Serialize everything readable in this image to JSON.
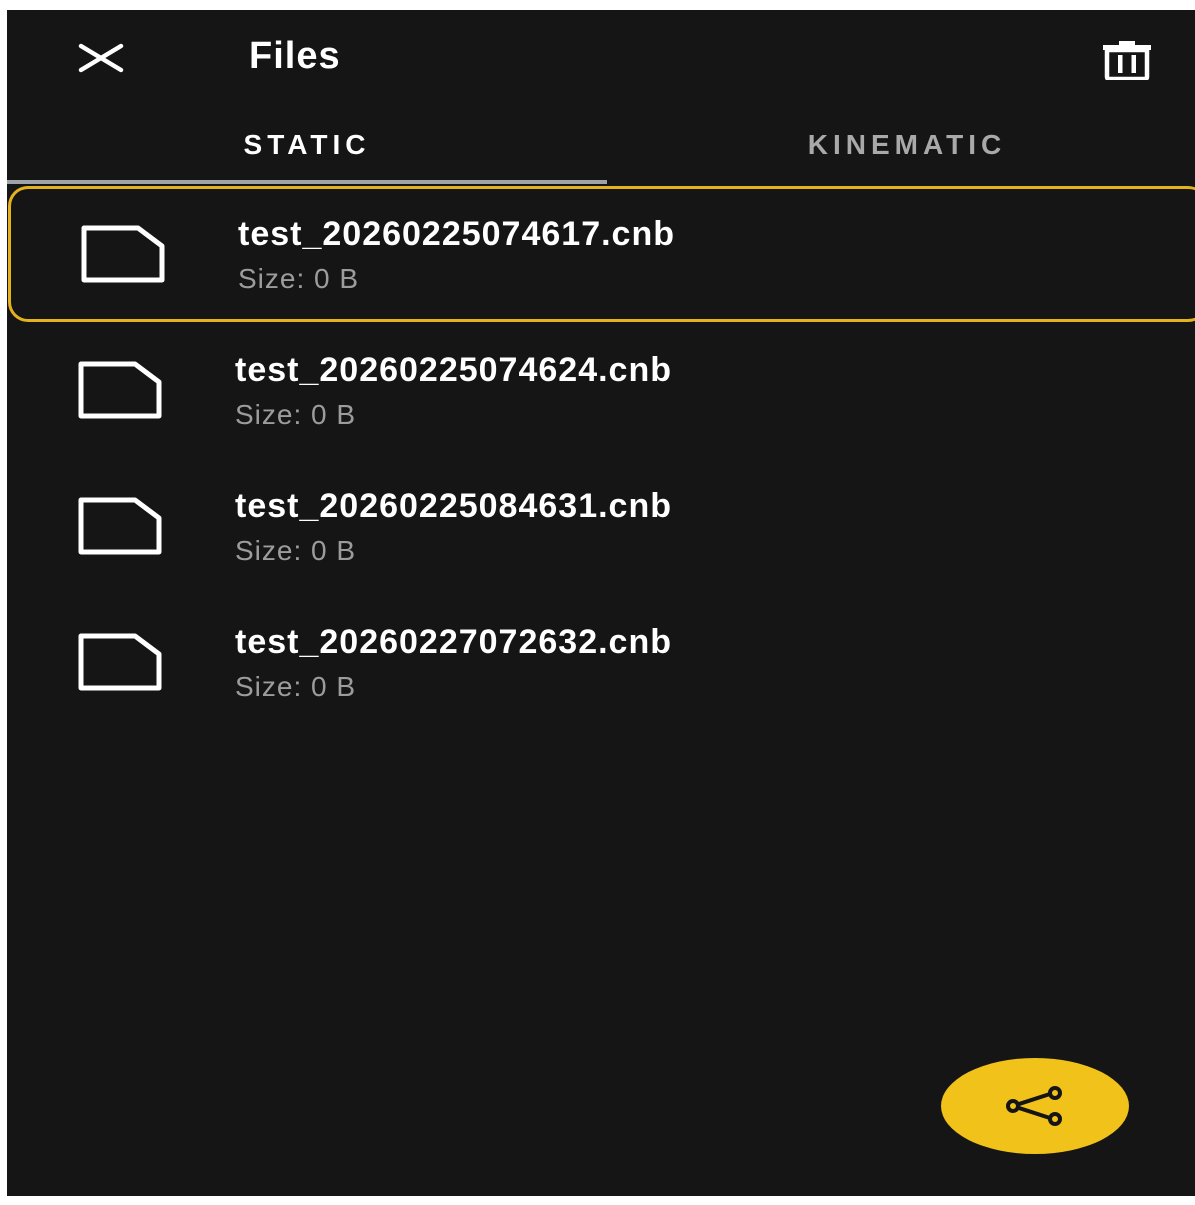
{
  "appbar": {
    "title": "Files",
    "close_icon": "close-icon",
    "delete_icon": "trash-icon"
  },
  "tabs": [
    {
      "label": "STATIC",
      "selected": true
    },
    {
      "label": "KINEMATIC",
      "selected": false
    }
  ],
  "files": [
    {
      "name": "test_20260225074617.cnb",
      "size": "Size: 0 B",
      "selected": true
    },
    {
      "name": "test_20260225074624.cnb",
      "size": "Size: 0 B",
      "selected": false
    },
    {
      "name": "test_20260225084631.cnb",
      "size": "Size: 0 B",
      "selected": false
    },
    {
      "name": "test_20260227072632.cnb",
      "size": "Size: 0 B",
      "selected": false
    }
  ],
  "fab": {
    "icon": "share-icon"
  },
  "colors": {
    "background": "#151515",
    "accent": "#f0c21a",
    "selection_border": "#e4b21f",
    "text_primary": "#ffffff",
    "text_secondary": "#9c9c9c",
    "tab_inactive": "#a9a9a9",
    "tab_indicator": "#9ea3a8"
  }
}
